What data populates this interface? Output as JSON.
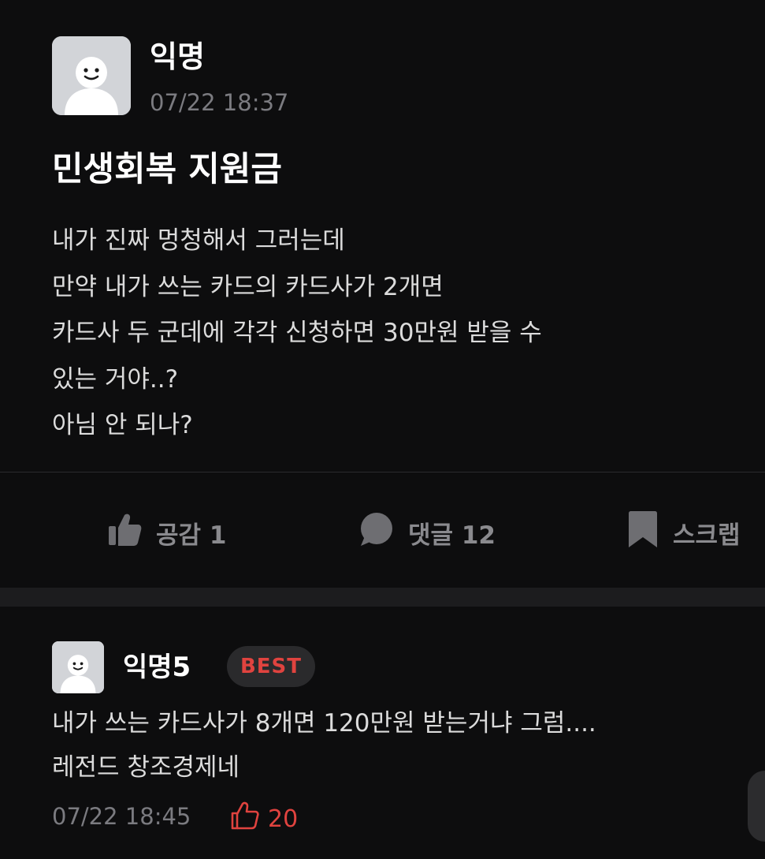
{
  "post": {
    "author": "익명",
    "timestamp": "07/22 18:37",
    "title": "민생회복 지원금",
    "body_lines": [
      "내가 진짜 멍청해서 그러는데",
      "만약 내가 쓰는 카드의 카드사가 2개면",
      "카드사 두 군데에 각각 신청하면 30만원 받을 수",
      "있는 거야..?",
      "아님 안 되나?"
    ]
  },
  "actions": {
    "like_label": "공감 1",
    "comment_label": "댓글 12",
    "scrap_label": "스크랩",
    "like_icon": "thumbs-up-icon",
    "comment_icon": "speech-bubble-icon",
    "scrap_icon": "bookmark-icon"
  },
  "best_comment": {
    "author": "익명5",
    "badge": "BEST",
    "body_lines": [
      "내가 쓰는 카드사가 8개면 120만원 받는거냐 그럼....",
      "레전드 창조경제네"
    ],
    "timestamp": "07/22 18:45",
    "likes": "20",
    "like_icon": "thumbs-up-outline-icon"
  },
  "colors": {
    "background": "#0d0d0e",
    "accent_red": "#e0433f",
    "muted": "#7b7b80",
    "avatar": "#d2d4d8"
  }
}
